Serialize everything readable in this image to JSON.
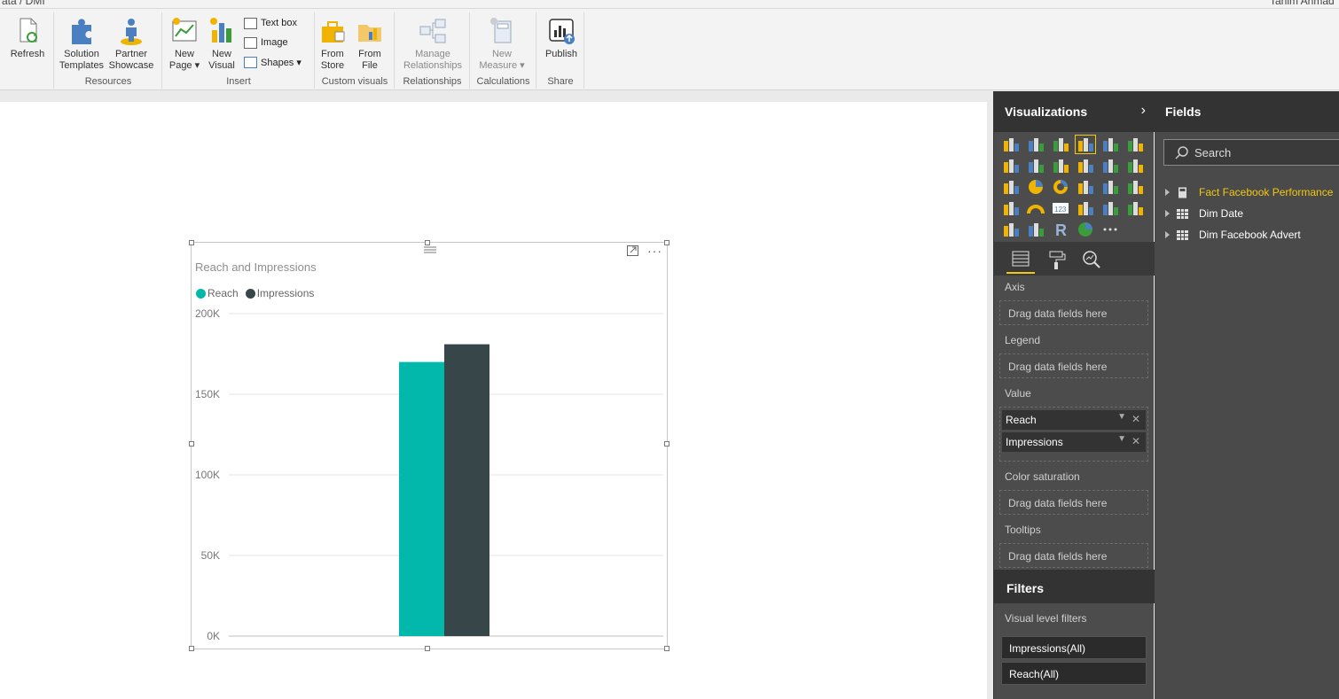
{
  "titlebar": {
    "left_text": "ata / DMI",
    "right_text": "Tahim Ahmad"
  },
  "ribbon": {
    "refresh": "Refresh",
    "solution_templates": [
      "Solution",
      "Templates"
    ],
    "partner_showcase": [
      "Partner",
      "Showcase"
    ],
    "resources_label": "Resources",
    "new_page": [
      "New",
      "Page ▾"
    ],
    "new_visual": [
      "New",
      "Visual"
    ],
    "text_box": "Text box",
    "image": "Image",
    "shapes": "Shapes ▾",
    "insert_label": "Insert",
    "from_store": [
      "From",
      "Store"
    ],
    "from_file": [
      "From",
      "File"
    ],
    "custom_visuals_label": "Custom visuals",
    "manage_relationships": [
      "Manage",
      "Relationships"
    ],
    "relationships_label": "Relationships",
    "new_measure": [
      "New",
      "Measure ▾"
    ],
    "calculations_label": "Calculations",
    "publish": "Publish",
    "share_label": "Share"
  },
  "visual": {
    "title": "Reach and Impressions",
    "legend": [
      {
        "name": "Reach",
        "color": "#01b8aa"
      },
      {
        "name": "Impressions",
        "color": "#374649"
      }
    ]
  },
  "chart_data": {
    "type": "bar",
    "title": "Reach and Impressions",
    "categories": [
      ""
    ],
    "series": [
      {
        "name": "Reach",
        "values": [
          170000
        ],
        "color": "#01b8aa"
      },
      {
        "name": "Impressions",
        "values": [
          181000
        ],
        "color": "#374649"
      }
    ],
    "ylim": [
      0,
      200000
    ],
    "yticks": [
      "200K",
      "150K",
      "100K",
      "50K",
      "0K"
    ],
    "ytick_values": [
      200000,
      150000,
      100000,
      50000,
      0
    ],
    "grid": true,
    "legend_position": "top-left"
  },
  "visualizations": {
    "title": "Visualizations",
    "wells": {
      "axis_label": "Axis",
      "axis_placeholder": "Drag data fields here",
      "legend_label": "Legend",
      "legend_placeholder": "Drag data fields here",
      "value_label": "Value",
      "value_items": [
        "Reach",
        "Impressions"
      ],
      "color_saturation_label": "Color saturation",
      "color_saturation_placeholder": "Drag data fields here",
      "tooltips_label": "Tooltips",
      "tooltips_placeholder": "Drag data fields here"
    },
    "filters": {
      "title": "Filters",
      "visual_level_label": "Visual level filters",
      "items": [
        "Impressions(All)",
        "Reach(All)"
      ]
    }
  },
  "fields": {
    "title": "Fields",
    "search_placeholder": "Search",
    "tables": [
      "Fact Facebook Performance",
      "Dim Date",
      "Dim Facebook Advert"
    ]
  },
  "colors": {
    "accent": "#f2c811",
    "reach": "#01b8aa",
    "impressions": "#374649"
  }
}
